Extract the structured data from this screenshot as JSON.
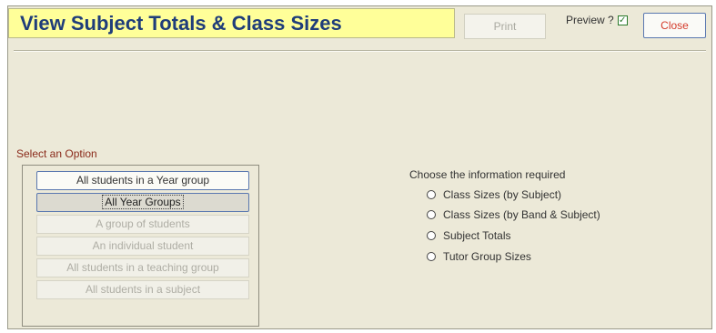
{
  "header": {
    "title": "View Subject Totals & Class Sizes",
    "print_label": "Print",
    "preview_label": "Preview ?",
    "preview_checked": true,
    "close_label": "Close"
  },
  "options": {
    "section_label": "Select an Option",
    "items": [
      {
        "label": "All students in a Year group",
        "state": "active"
      },
      {
        "label": "All Year Groups",
        "state": "selected"
      },
      {
        "label": "A group of students",
        "state": "disabled"
      },
      {
        "label": "An individual student",
        "state": "disabled"
      },
      {
        "label": "All students in a teaching group",
        "state": "disabled"
      },
      {
        "label": "All students in a subject",
        "state": "disabled"
      }
    ]
  },
  "info": {
    "label": "Choose the information required",
    "radios": [
      {
        "label": "Class Sizes (by Subject)",
        "checked": false
      },
      {
        "label": "Class Sizes (by Band & Subject)",
        "checked": false
      },
      {
        "label": "Subject Totals",
        "checked": false
      },
      {
        "label": "Tutor Group Sizes",
        "checked": false
      }
    ]
  },
  "colors": {
    "title_bg": "#ffff99",
    "title_text": "#1f3d7a",
    "panel_bg": "#ece9d8",
    "close_text": "#d43a2a",
    "section_label": "#8a2a1a"
  }
}
